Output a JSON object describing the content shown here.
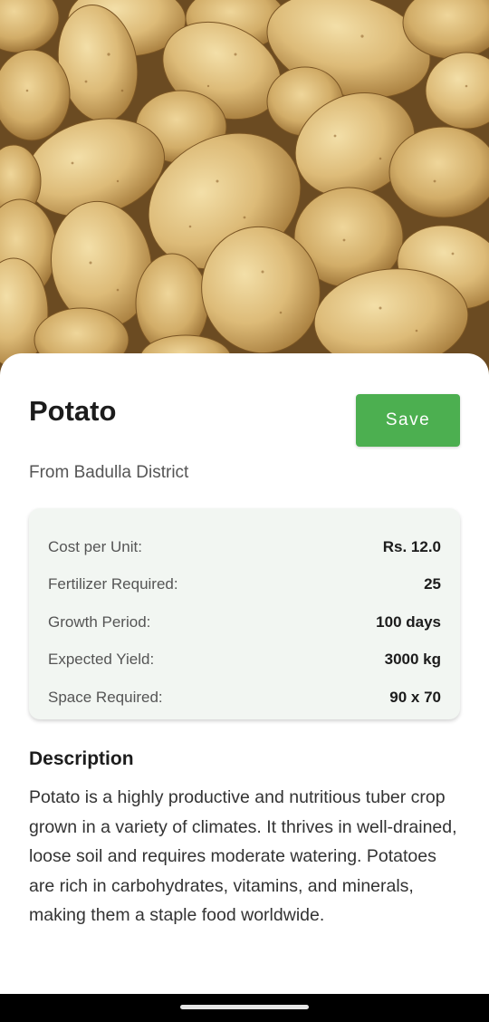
{
  "hero": {
    "image": "potatoes-photo"
  },
  "crop": {
    "name": "Potato",
    "origin": "From Badulla District",
    "save_label": "Save"
  },
  "specs": [
    {
      "label": "Cost per Unit:",
      "value": "Rs. 12.0"
    },
    {
      "label": "Fertilizer Required:",
      "value": "25"
    },
    {
      "label": "Growth Period:",
      "value": "100 days"
    },
    {
      "label": "Expected Yield:",
      "value": "3000 kg"
    },
    {
      "label": "Space Required:",
      "value": "90 x 70"
    }
  ],
  "description": {
    "heading": "Description",
    "text": "Potato is a highly productive and nutritious tuber crop grown in a variety of climates. It thrives in well-drained, loose soil and requires moderate watering. Potatoes are rich in carbohydrates, vitamins, and minerals, making them a staple food worldwide."
  },
  "colors": {
    "accent": "#4caf50",
    "card_bg": "#f2f6f2"
  }
}
